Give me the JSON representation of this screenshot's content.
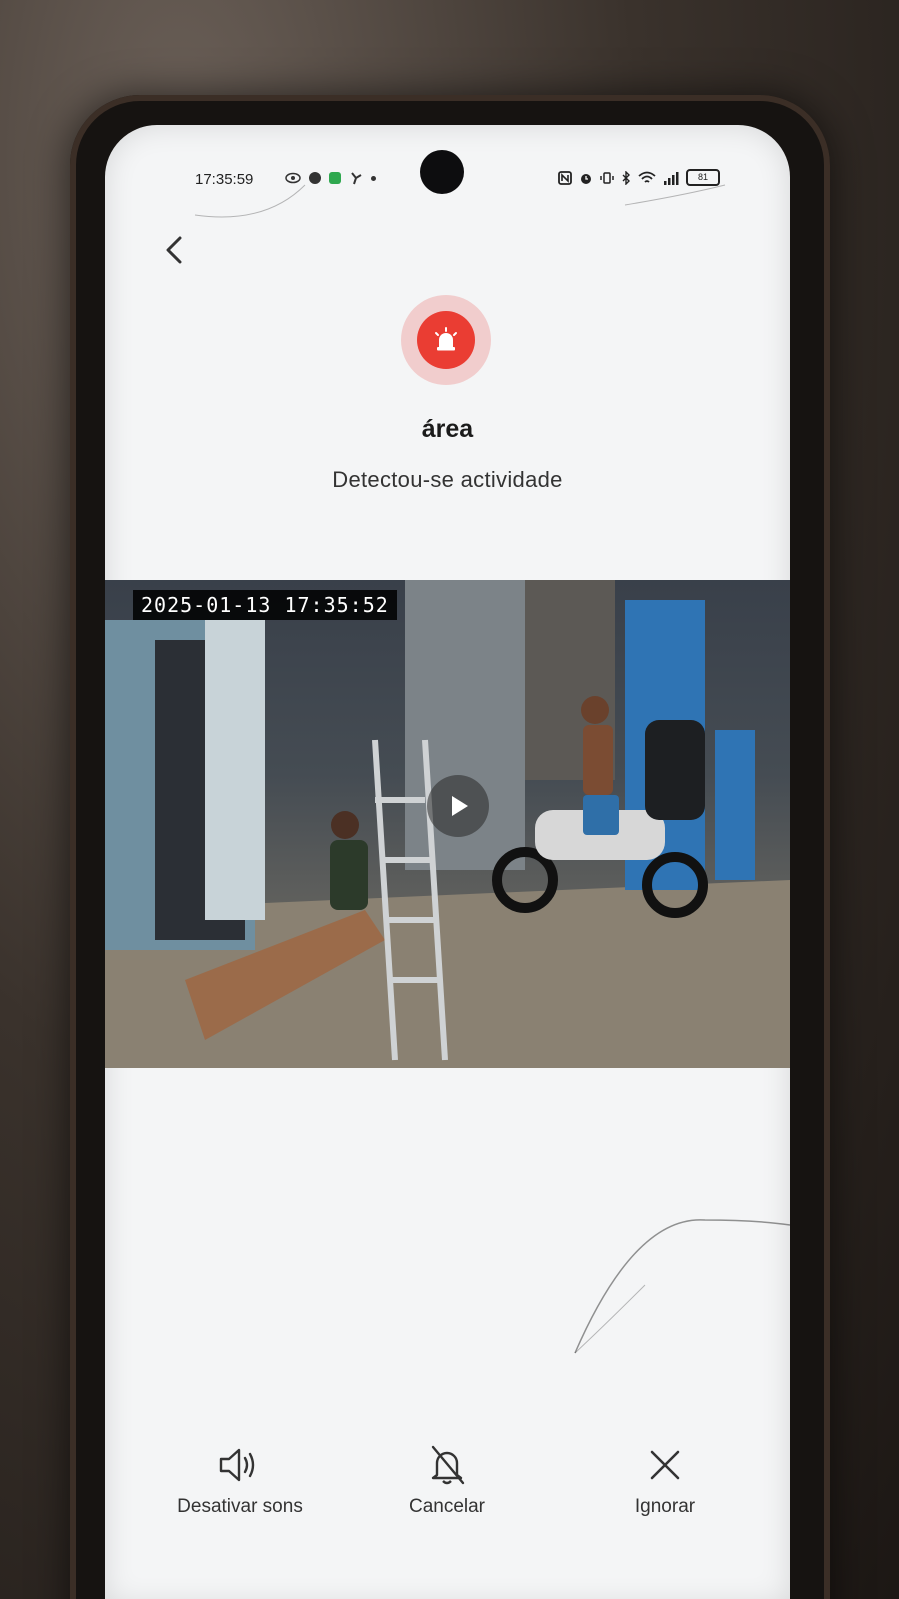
{
  "status_bar": {
    "time": "17:35:59",
    "battery": "81"
  },
  "alert": {
    "title": "área",
    "message": "Detectou-se actividade",
    "accent_color": "#ea3d33",
    "icon": "alarm-siren-icon"
  },
  "snapshot": {
    "timestamp": "2025-01-13  17:35:52",
    "play_icon": "play-icon"
  },
  "actions": [
    {
      "label": "Desativar sons",
      "icon": "speaker-icon"
    },
    {
      "label": "Cancelar",
      "icon": "bell-off-icon"
    },
    {
      "label": "Ignorar",
      "icon": "close-icon"
    }
  ]
}
